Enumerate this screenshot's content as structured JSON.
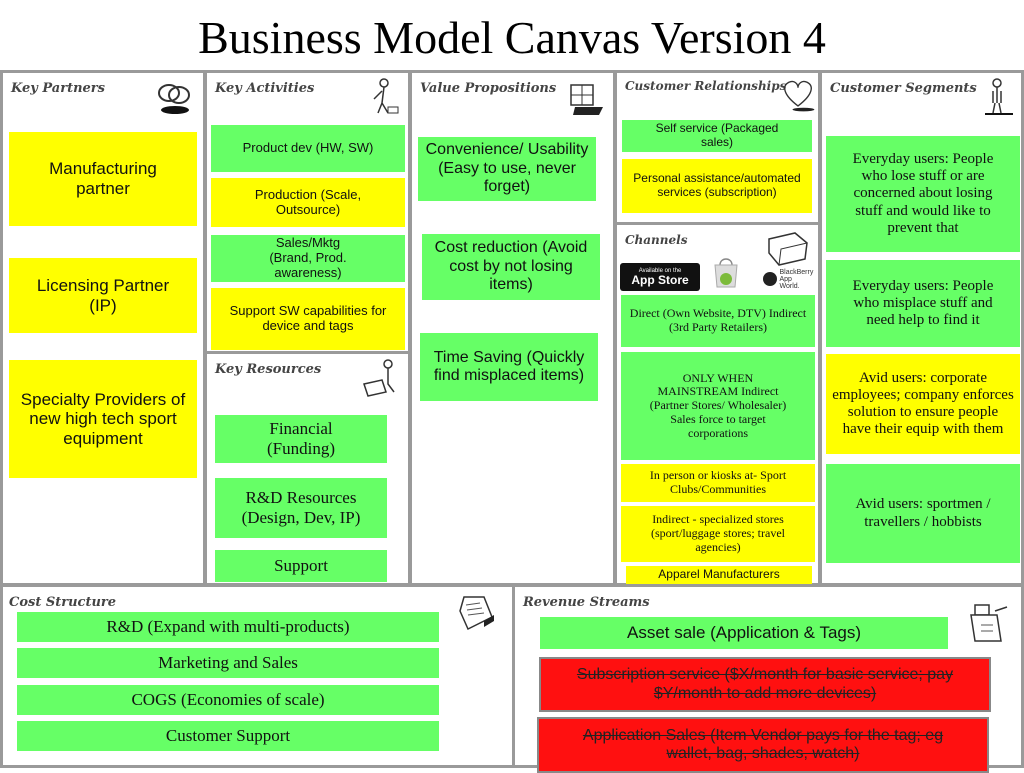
{
  "title": "Business Model Canvas Version 4",
  "colors": {
    "green": "#66ff66",
    "yellow": "#ffff00",
    "red": "#ff1010",
    "border": "#9a9a9a"
  },
  "key_partners": {
    "heading": "Key Partners",
    "icon": "chain-links-icon",
    "items": [
      {
        "text": "Manufacturing partner",
        "color": "yellow"
      },
      {
        "text": "Licensing Partner (IP)",
        "color": "yellow"
      },
      {
        "text": "Specialty Providers of new high tech sport equipment",
        "color": "yellow"
      }
    ]
  },
  "key_activities": {
    "heading": "Key Activities",
    "icon": "worker-icon",
    "items": [
      {
        "text": "Product dev (HW, SW)",
        "color": "green"
      },
      {
        "text": "Production (Scale, Outsource)",
        "color": "yellow"
      },
      {
        "text": "Sales/Mktg (Brand, Prod. awareness)",
        "color": "green"
      },
      {
        "text": "Support SW capabilities for device and tags",
        "color": "yellow"
      }
    ]
  },
  "key_resources": {
    "heading": "Key Resources",
    "icon": "person-with-cart-icon",
    "items": [
      {
        "text": "Financial (Funding)",
        "color": "green"
      },
      {
        "text": "R&D Resources (Design, Dev, IP)",
        "color": "green"
      },
      {
        "text": "Support",
        "color": "green"
      }
    ]
  },
  "value_propositions": {
    "heading": "Value Propositions",
    "icon": "gift-box-icon",
    "items": [
      {
        "text": "Convenience/ Usability (Easy to use, never forget)",
        "color": "green"
      },
      {
        "text": "Cost reduction (Avoid cost by not losing items)",
        "color": "green"
      },
      {
        "text": "Time Saving (Quickly find misplaced items)",
        "color": "green"
      }
    ]
  },
  "customer_relationships": {
    "heading": "Customer Relationships",
    "icon": "heart-icon",
    "items": [
      {
        "text": "Self service (Packaged sales)",
        "color": "green"
      },
      {
        "text": "Personal assistance/automated services (subscription)",
        "color": "yellow"
      }
    ]
  },
  "channels": {
    "heading": "Channels",
    "icon": "delivery-truck-icon",
    "badges": {
      "app_store_small": "Available on the",
      "app_store": "App Store",
      "blackberry": "BlackBerry App World."
    },
    "items": [
      {
        "text": "Direct (Own Website, DTV) Indirect (3rd Party Retailers)",
        "color": "green"
      },
      {
        "text": "ONLY WHEN MAINSTREAM Indirect (Partner Stores/ Wholesaler) Sales force to target corporations",
        "color": "green"
      },
      {
        "text": "In person or kiosks at- Sport Clubs/Communities",
        "color": "yellow"
      },
      {
        "text": "Indirect - specialized stores (sport/luggage stores; travel agencies)",
        "color": "yellow"
      },
      {
        "text": "Apparel Manufacturers",
        "color": "yellow"
      }
    ]
  },
  "customer_segments": {
    "heading": "Customer Segments",
    "icon": "standing-person-icon",
    "items": [
      {
        "text": "Everyday users: People who lose stuff or are concerned about losing stuff and would like to prevent that",
        "color": "green"
      },
      {
        "text": "Everyday users: People who misplace stuff and need help to find it",
        "color": "green"
      },
      {
        "text": "Avid users: corporate employees; company enforces solution to ensure people have their equip with them",
        "color": "yellow"
      },
      {
        "text": "Avid users: sportmen / travellers / hobbists",
        "color": "green"
      }
    ]
  },
  "cost_structure": {
    "heading": "Cost Structure",
    "icon": "receipt-icon",
    "items": [
      {
        "text": "R&D (Expand with multi-products)",
        "color": "green"
      },
      {
        "text": "Marketing and Sales",
        "color": "green"
      },
      {
        "text": "COGS (Economies of scale)",
        "color": "green"
      },
      {
        "text": "Customer Support",
        "color": "green"
      }
    ]
  },
  "revenue_streams": {
    "heading": "Revenue Streams",
    "icon": "cash-register-icon",
    "items": [
      {
        "text": "Asset sale (Application & Tags)",
        "color": "green"
      },
      {
        "text": "Subscription service  ($X/month for basic service; pay $Y/month to add more devices)",
        "color": "red",
        "struck": true
      },
      {
        "text": "Application Sales (Item Vendor pays for the tag; eg wallet, bag, shades, watch)",
        "color": "red",
        "struck": true
      }
    ]
  }
}
